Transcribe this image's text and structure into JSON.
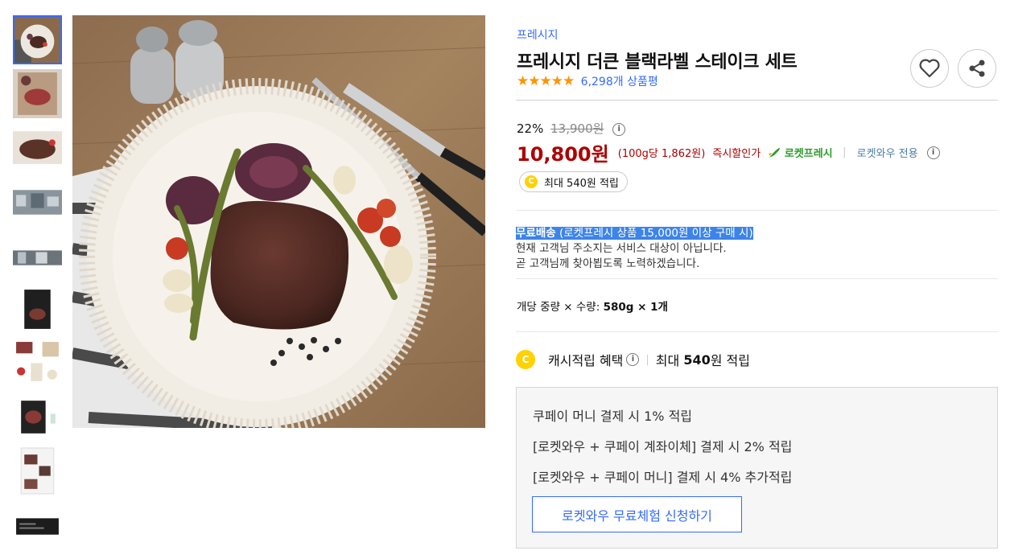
{
  "product": {
    "brand": "프레시지",
    "title": "프레시지 더큰 블랙라벨 스테이크 세트",
    "rating_stars": "★★★★★",
    "review_count": "6,298개 상품평"
  },
  "icons": {
    "wishlist": "heart-icon",
    "share": "share-icon",
    "info": "info-icon",
    "rocket": "rocket-icon",
    "coin": "coin-icon"
  },
  "pricing": {
    "discount_rate": "22%",
    "original_price": "13,900원",
    "info_glyph": "i",
    "sale_price": "10,800원",
    "unit_price": "(100g당 1,862원)",
    "instant_discount": "즉시할인가",
    "rocket_label": "로켓프레시",
    "wow_label": "로켓와우 전용",
    "reward": "최대 540원 적립",
    "coin_glyph": "C"
  },
  "shipping": {
    "highlight_strong": "무료배송",
    "highlight_rest": " (로켓프레시 상품 15,000원 이상 구매 시)",
    "line2": "현재 고객님 주소지는 서비스 대상이 아닙니다.",
    "line3": "곧 고객님께 찾아뵙도록 노력하겠습니다."
  },
  "quantity": {
    "label": "개당 중량 × 수량:",
    "value": "580g × 1개"
  },
  "cash": {
    "label": "캐시적립 혜택",
    "prefix": "최대",
    "amount": "540",
    "suffix": "원 적립"
  },
  "benefits": {
    "lines": [
      "쿠페이 머니 결제 시 1% 적립",
      "[로켓와우 + 쿠페이 계좌이체] 결제 시 2% 적립",
      "[로켓와우 + 쿠페이 머니] 결제 시 4% 추가적립"
    ],
    "trial_button": "로켓와우 무료체험 신청하기"
  },
  "colors": {
    "accent": "#346aff",
    "price": "#ae0000",
    "rocket": "#2b9c29",
    "star": "#ff9400",
    "highlight": "#3c84e8"
  }
}
